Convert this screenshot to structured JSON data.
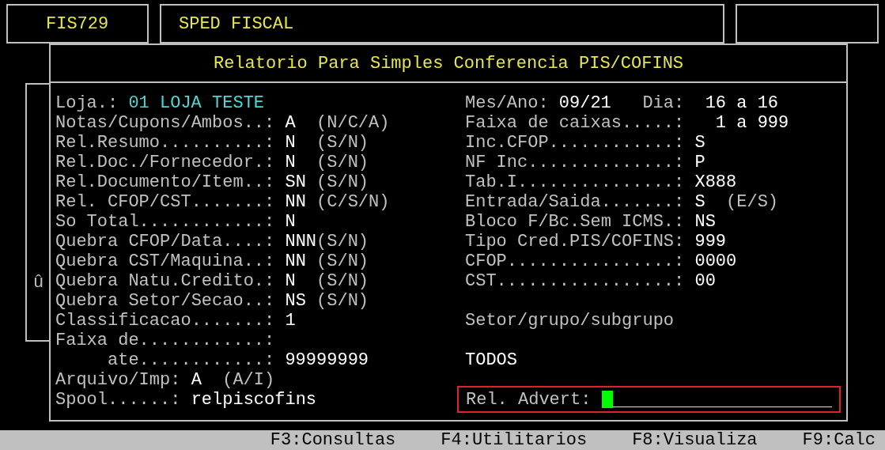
{
  "top_bar": {
    "code": "FIS729",
    "module": "SPED FISCAL"
  },
  "dialog": {
    "title": "Relatorio Para Simples Conferencia PIS/COFINS",
    "side_mark": "û",
    "left": [
      {
        "kind": "field",
        "label": "Loja.:",
        "value": "01 LOJA TESTE",
        "highlight": true
      },
      {
        "kind": "field",
        "label": "Notas/Cupons/Ambos..:",
        "value": "A",
        "hint": "(N/C/A)"
      },
      {
        "kind": "field",
        "label": "Rel.Resumo..........:",
        "value": "N",
        "hint": "(S/N)"
      },
      {
        "kind": "field",
        "label": "Rel.Doc./Fornecedor.:",
        "value": "N",
        "hint": "(S/N)"
      },
      {
        "kind": "field",
        "label": "Rel.Documento/Item..:",
        "value": "SN",
        "hint": "(S/N)"
      },
      {
        "kind": "field",
        "label": "Rel. CFOP/CST.......:",
        "value": "NN",
        "hint": "(C/S/N)"
      },
      {
        "kind": "field",
        "label": "So Total............:",
        "value": "N"
      },
      {
        "kind": "field",
        "label": "Quebra CFOP/Data....:",
        "value": "NNN",
        "hint": "(S/N)"
      },
      {
        "kind": "field",
        "label": "Quebra CST/Maquina..:",
        "value": "NN",
        "hint": "(S/N)"
      },
      {
        "kind": "field",
        "label": "Quebra Natu.Credito.:",
        "value": "N",
        "hint": "(S/N)"
      },
      {
        "kind": "field",
        "label": "Quebra Setor/Secao..:",
        "value": "NS",
        "hint": "(S/N)"
      },
      {
        "kind": "field",
        "label": "Classificacao.......:",
        "value": "1"
      },
      {
        "kind": "field",
        "label": "Faixa de............:"
      },
      {
        "kind": "subfield",
        "label": "ate............:",
        "value": "99999999"
      },
      {
        "kind": "short",
        "label": "Arquivo/Imp:",
        "value": "A",
        "hint": "(A/I)"
      },
      {
        "kind": "short",
        "label": "Spool......:",
        "value": "relpiscofins"
      }
    ],
    "right": [
      {
        "kind": "pair",
        "label": "Mes/Ano:",
        "value": "09/21",
        "label2": "Dia:",
        "value2": "16 a 16"
      },
      {
        "kind": "field",
        "label": "Faixa de caixas.....:",
        "value": "1 a 999",
        "indent": true
      },
      {
        "kind": "field",
        "label": "Inc.CFOP............:",
        "value": "S"
      },
      {
        "kind": "field",
        "label": "NF Inc..............:",
        "value": "P"
      },
      {
        "kind": "field",
        "label": "Tab.I...............:",
        "value": "X888"
      },
      {
        "kind": "field",
        "label": "Entrada/Saida.......:",
        "value": "S",
        "hint": "(E/S)"
      },
      {
        "kind": "field",
        "label": "Bloco F/Bc.Sem ICMS.:",
        "value": "NS"
      },
      {
        "kind": "field",
        "label": "Tipo Cred.PIS/COFINS:",
        "value": "999"
      },
      {
        "kind": "field",
        "label": "CFOP................:",
        "value": "0000"
      },
      {
        "kind": "field",
        "label": "CST.................:",
        "value": "00"
      },
      {
        "kind": "heading",
        "label": "Setor/grupo/subgrupo"
      },
      {
        "kind": "value",
        "value": "TODOS"
      },
      {
        "kind": "input",
        "label": "Rel. Advert:",
        "focused": true
      }
    ]
  },
  "function_keys": [
    "F3:Consultas",
    "F4:Utilitarios",
    "F8:Visualiza",
    "F9:Calc"
  ]
}
